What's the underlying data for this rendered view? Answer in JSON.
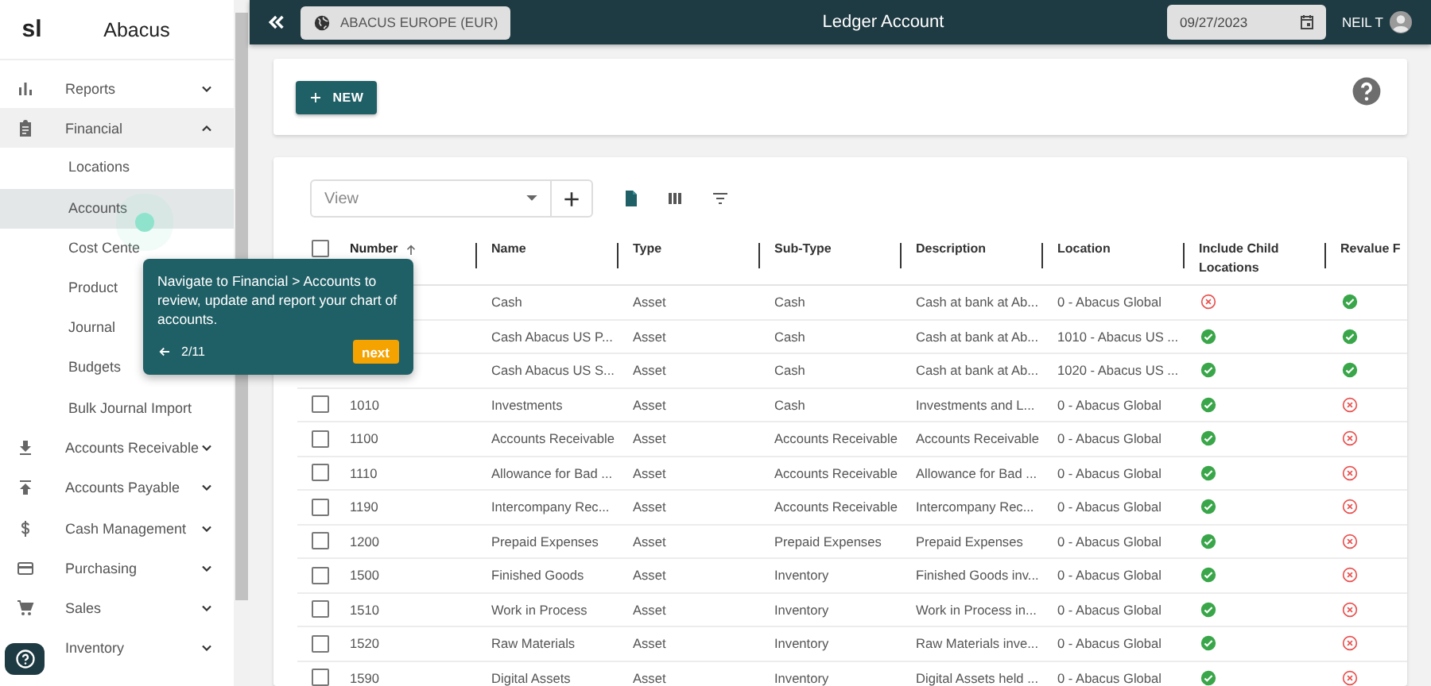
{
  "sidebar": {
    "brand_mark": "sl",
    "brand_name": "Abacus",
    "items": [
      {
        "label": "Reports",
        "expanded": false
      },
      {
        "label": "Financial",
        "expanded": true,
        "children": [
          {
            "label": "Locations",
            "selected": false
          },
          {
            "label": "Accounts",
            "selected": true
          },
          {
            "label": "Cost Cente",
            "selected": false
          },
          {
            "label": "Product",
            "selected": false
          },
          {
            "label": "Journal",
            "selected": false
          },
          {
            "label": "Budgets",
            "selected": false
          },
          {
            "label": "Bulk Journal Import",
            "selected": false
          }
        ]
      },
      {
        "label": "Accounts Receivable",
        "expanded": false
      },
      {
        "label": "Accounts Payable",
        "expanded": false
      },
      {
        "label": "Cash Management",
        "expanded": false
      },
      {
        "label": "Purchasing",
        "expanded": false
      },
      {
        "label": "Sales",
        "expanded": false
      },
      {
        "label": "Inventory",
        "expanded": false
      }
    ]
  },
  "top_bar": {
    "entity": "ABACUS EUROPE (EUR)",
    "title": "Ledger Account",
    "date": "09/27/2023",
    "user": "NEIL T"
  },
  "toolbar": {
    "new_button": "NEW"
  },
  "view_select": {
    "placeholder": "View"
  },
  "table": {
    "columns": [
      {
        "label": "Number",
        "sorted": true
      },
      {
        "label": "Name",
        "sorted": false
      },
      {
        "label": "Type",
        "sorted": false
      },
      {
        "label": "Sub-Type",
        "sorted": false
      },
      {
        "label": "Description",
        "sorted": false
      },
      {
        "label": "Location",
        "sorted": false
      },
      {
        "label": "Include Child Locations",
        "sorted": false
      },
      {
        "label": "Revalue F",
        "sorted": false
      }
    ],
    "header_checked": false,
    "rows": [
      {
        "name": "Cash",
        "type": "Asset",
        "sub_type": "Cash",
        "description": "Cash at bank at Ab...",
        "location": "0 - Abacus Global",
        "include_child": false,
        "revalue": true
      },
      {
        "name": "Cash Abacus US P...",
        "type": "Asset",
        "sub_type": "Cash",
        "description": "Cash at bank at Ab...",
        "location": "1010 - Abacus US ...",
        "include_child": true,
        "revalue": true
      },
      {
        "name": "Cash Abacus US S...",
        "type": "Asset",
        "sub_type": "Cash",
        "description": "Cash at bank at Ab...",
        "location": "1020 - Abacus US ...",
        "include_child": true,
        "revalue": true
      },
      {
        "checked": false,
        "number": "1010",
        "name": "Investments",
        "type": "Asset",
        "sub_type": "Cash",
        "description": "Investments and L...",
        "location": "0 - Abacus Global",
        "include_child": true,
        "revalue": false
      },
      {
        "checked": false,
        "number": "1100",
        "name": "Accounts Receivable",
        "type": "Asset",
        "sub_type": "Accounts Receivable",
        "description": "Accounts Receivable",
        "location": "0 - Abacus Global",
        "include_child": true,
        "revalue": false
      },
      {
        "checked": false,
        "number": "1110",
        "name": "Allowance for Bad ...",
        "type": "Asset",
        "sub_type": "Accounts Receivable",
        "description": "Allowance for Bad ...",
        "location": "0 - Abacus Global",
        "include_child": true,
        "revalue": false
      },
      {
        "checked": false,
        "number": "1190",
        "name": "Intercompany Rec...",
        "type": "Asset",
        "sub_type": "Accounts Receivable",
        "description": "Intercompany Rec...",
        "location": "0 - Abacus Global",
        "include_child": true,
        "revalue": false
      },
      {
        "checked": false,
        "number": "1200",
        "name": "Prepaid Expenses",
        "type": "Asset",
        "sub_type": "Prepaid Expenses",
        "description": "Prepaid Expenses",
        "location": "0 - Abacus Global",
        "include_child": true,
        "revalue": false
      },
      {
        "checked": false,
        "number": "1500",
        "name": "Finished Goods",
        "type": "Asset",
        "sub_type": "Inventory",
        "description": "Finished Goods inv...",
        "location": "0 - Abacus Global",
        "include_child": true,
        "revalue": false
      },
      {
        "checked": false,
        "number": "1510",
        "name": "Work in Process",
        "type": "Asset",
        "sub_type": "Inventory",
        "description": "Work in Process in...",
        "location": "0 - Abacus Global",
        "include_child": true,
        "revalue": false
      },
      {
        "checked": false,
        "number": "1520",
        "name": "Raw Materials",
        "type": "Asset",
        "sub_type": "Inventory",
        "description": "Raw Materials inve...",
        "location": "0 - Abacus Global",
        "include_child": true,
        "revalue": false
      },
      {
        "checked": false,
        "number": "1590",
        "name": "Digital Assets",
        "type": "Asset",
        "sub_type": "Inventory",
        "description": "Digital Assets held ...",
        "location": "0 - Abacus Global",
        "include_child": true,
        "revalue": false
      }
    ]
  },
  "tour": {
    "text": "Navigate to Financial > Accounts to review, update and report your chart of accounts.",
    "step": "2/11",
    "next_button": "next"
  }
}
